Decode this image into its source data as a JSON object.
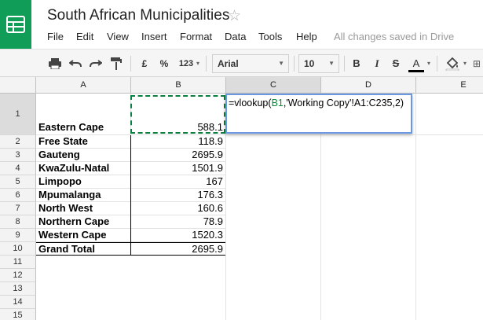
{
  "header": {
    "title": "South African Municipalities",
    "menu": [
      "File",
      "Edit",
      "View",
      "Insert",
      "Format",
      "Data",
      "Tools",
      "Help"
    ],
    "save_status": "All changes saved in Drive"
  },
  "toolbar": {
    "currency": "£",
    "percent": "%",
    "number_format": "123",
    "font": "Arial",
    "font_size": "10",
    "bold": "B",
    "italic": "I",
    "strikethrough": "S",
    "text_color": "A"
  },
  "columns": [
    "A",
    "B",
    "C",
    "D",
    "E"
  ],
  "rows": [
    "1",
    "2",
    "3",
    "4",
    "5",
    "6",
    "7",
    "8",
    "9",
    "10",
    "11",
    "12",
    "13",
    "14",
    "15"
  ],
  "table": [
    {
      "province": "Eastern Cape",
      "value": "588.1"
    },
    {
      "province": "Free State",
      "value": "118.9"
    },
    {
      "province": "Gauteng",
      "value": "2695.9"
    },
    {
      "province": "KwaZulu-Natal",
      "value": "1501.9"
    },
    {
      "province": "Limpopo",
      "value": "167"
    },
    {
      "province": "Mpumalanga",
      "value": "176.3"
    },
    {
      "province": "North West",
      "value": "160.6"
    },
    {
      "province": "Northern Cape",
      "value": "78.9"
    },
    {
      "province": "Western Cape",
      "value": "1520.3"
    },
    {
      "province": "Grand Total",
      "value": "2695.9"
    }
  ],
  "formula": {
    "prefix": "=vlookup(",
    "ref": "B1",
    "suffix": ",'Working Copy'!A1:C235,2)"
  },
  "colors": {
    "brand": "#0f9d58",
    "selection_border": "#6b98e0",
    "copy_marquee": "#0a7f3f"
  }
}
